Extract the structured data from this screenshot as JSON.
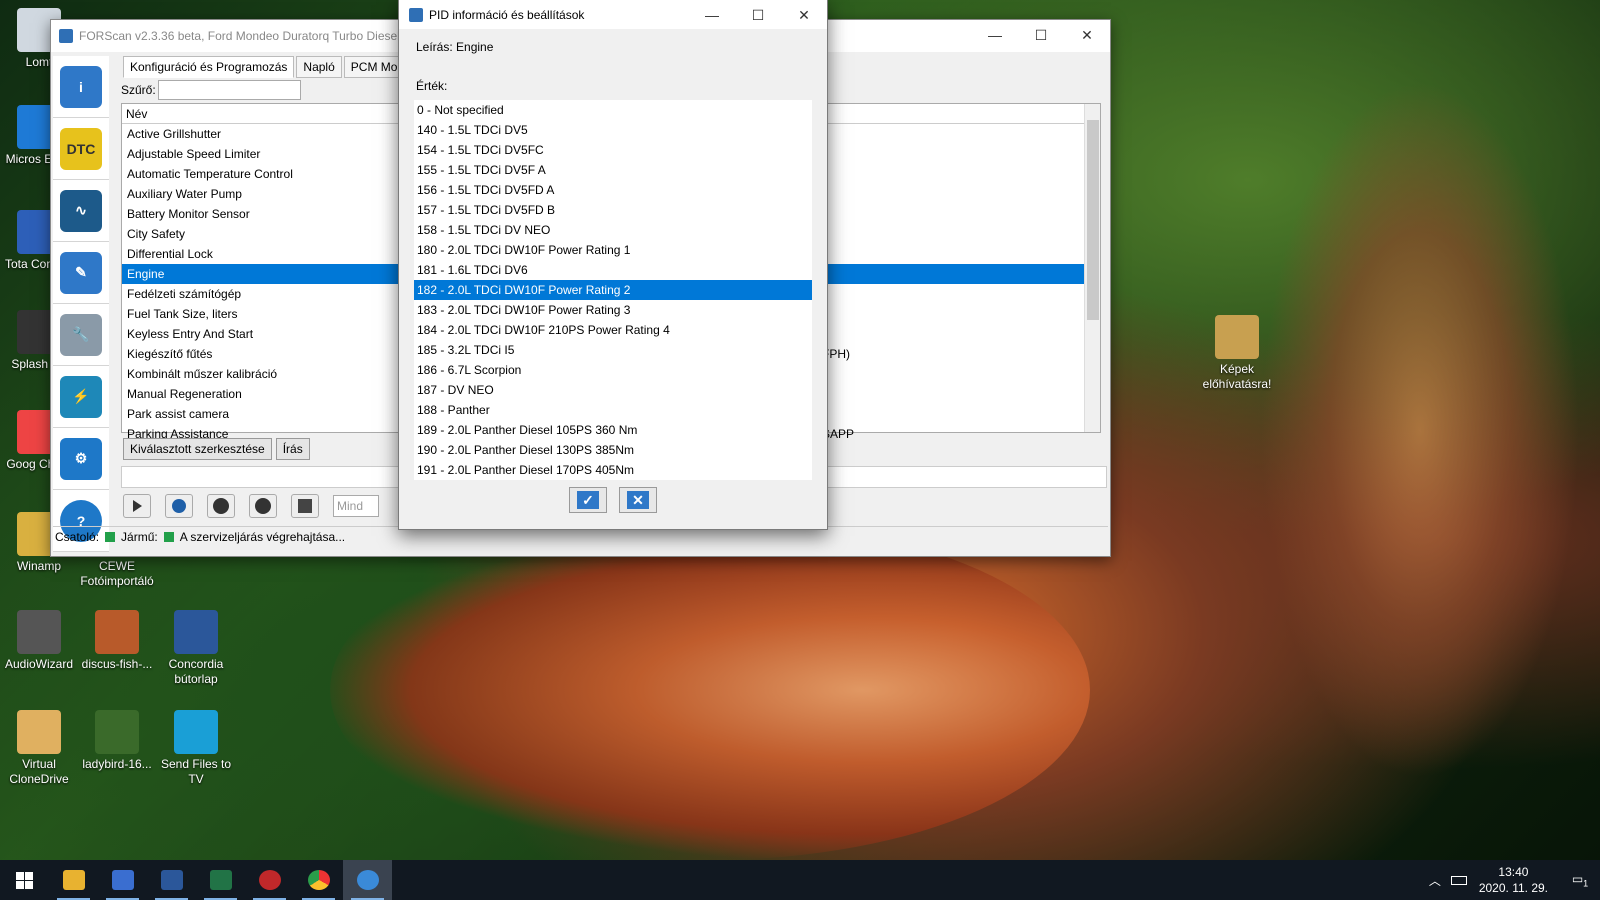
{
  "desktop": {
    "icons": [
      {
        "label": "Lomt",
        "color": "#d0d8e0"
      },
      {
        "label": "Micros Edge",
        "color": "#1e7ad6"
      },
      {
        "label": "Tota Comma",
        "color": "#2d5fb8"
      },
      {
        "label": "Splash PF",
        "color": "#333"
      },
      {
        "label": "Goog Chron",
        "color": "#e44"
      },
      {
        "label": "Winamp",
        "color": "#d9b040"
      },
      {
        "label": "CEWE Fotóimportáló",
        "color": "#c22"
      },
      {
        "label": "AudioWizard",
        "color": "#555"
      },
      {
        "label": "discus-fish-...",
        "color": "#b85a2a"
      },
      {
        "label": "Concordia bútorlap",
        "color": "#2b579a"
      },
      {
        "label": "Virtual CloneDrive",
        "color": "#e0b060"
      },
      {
        "label": "ladybird-16...",
        "color": "#3a6a2a"
      },
      {
        "label": "Send Files to TV",
        "color": "#1a9fd6"
      },
      {
        "label": "Képek előhívatásra!",
        "color": "#c8a050"
      }
    ]
  },
  "main_window": {
    "title": "FORScan v2.3.36 beta, Ford Mondeo Duratorq Turbo Diesel C",
    "tabs": [
      "Konfiguráció és Programozás",
      "Napló",
      "PCM Mo"
    ],
    "filter_label": "Szűrő:",
    "column_name": "Név",
    "rows": [
      {
        "name": "Active Grillshutter",
        "val": ""
      },
      {
        "name": "Adjustable Speed Limiter",
        "val": ""
      },
      {
        "name": "Automatic Temperature Control",
        "val": ""
      },
      {
        "name": "Auxiliary Water Pump",
        "val": ""
      },
      {
        "name": "Battery Monitor Sensor",
        "val": ""
      },
      {
        "name": "City Safety",
        "val": ""
      },
      {
        "name": "Differential Lock",
        "val": ""
      },
      {
        "name": "Engine",
        "val": ""
      },
      {
        "name": "Fedélzeti számítógép",
        "val": ""
      },
      {
        "name": "Fuel Tank Size, liters",
        "val": ""
      },
      {
        "name": "Keyless Entry And Start",
        "val": ""
      },
      {
        "name": "Kiegészítő fűtés",
        "val": "FPH)"
      },
      {
        "name": "Kombinált műszer kalibráció",
        "val": ""
      },
      {
        "name": "Manual Regeneration",
        "val": ""
      },
      {
        "name": "Park assist camera",
        "val": ""
      },
      {
        "name": "Parking Assistance",
        "val": "SAPP"
      }
    ],
    "selected_row": "Engine",
    "edit_button": "Kiválasztott szerkesztése",
    "write_button": "Írás",
    "mode_input": "Mind",
    "status": {
      "adapter": "Csatoló:",
      "vehicle": "Jármű:",
      "message": "A szervizeljárás végrehajtása..."
    }
  },
  "dialog": {
    "title": "PID információ és beállítások",
    "description": "Leírás: Engine",
    "value_label": "Érték:",
    "items": [
      "0 - Not specified",
      "140 - 1.5L TDCi DV5",
      "154 - 1.5L TDCi DV5FC",
      "155 - 1.5L TDCi DV5F A",
      "156 - 1.5L TDCi DV5FD A",
      "157 - 1.5L TDCi DV5FD B",
      "158 - 1.5L TDCi DV NEO",
      "180 - 2.0L TDCi DW10F Power Rating 1",
      "181 - 1.6L TDCi DV6",
      "182 - 2.0L TDCi DW10F Power Rating 2",
      "183 - 2.0L TDCi DW10F Power Rating 3",
      "184 - 2.0L TDCi DW10F 210PS Power Rating 4",
      "185 - 3.2L TDCi I5",
      "186 - 6.7L Scorpion",
      "187 - DV NEO",
      "188 - Panther",
      "189 - 2.0L Panther Diesel 105PS 360 Nm",
      "190 - 2.0L Panther Diesel 130PS 385Nm",
      "191 - 2.0L Panther Diesel 170PS 405Nm"
    ],
    "selected": "182 - 2.0L TDCi DW10F Power Rating 2",
    "ok_glyph": "✓",
    "cancel_glyph": "✕"
  },
  "taskbar": {
    "time": "13:40",
    "date": "2020. 11. 29.",
    "notification_count": "1"
  },
  "colors": {
    "accent": "#0078d7",
    "status_green": "#22a04a"
  }
}
